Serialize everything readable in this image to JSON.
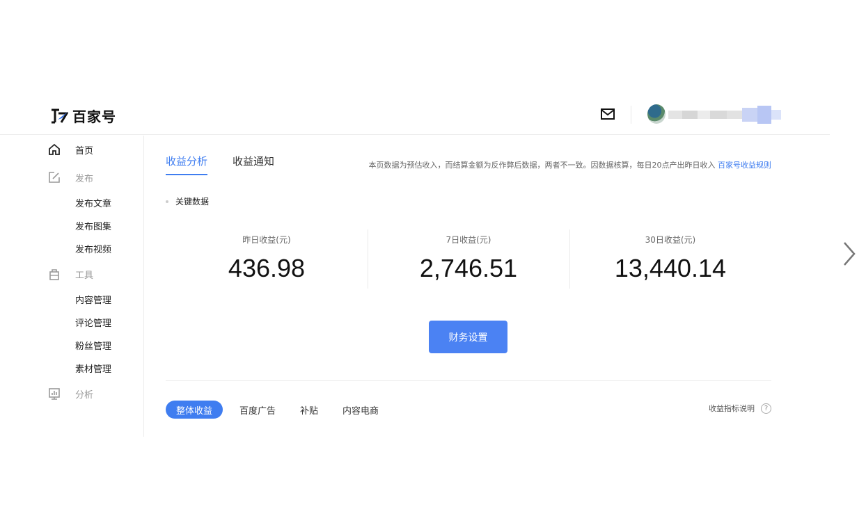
{
  "header": {
    "logo_text": "百家号",
    "mail_icon": "mail-icon",
    "avatar_icon": "avatar"
  },
  "sidebar": {
    "groups": [
      {
        "label": "首页",
        "icon": "home-icon",
        "items": []
      },
      {
        "label": "发布",
        "icon": "edit-icon",
        "items": [
          "发布文章",
          "发布图集",
          "发布视频"
        ]
      },
      {
        "label": "工具",
        "icon": "bag-icon",
        "items": [
          "内容管理",
          "评论管理",
          "粉丝管理",
          "素材管理"
        ]
      },
      {
        "label": "分析",
        "icon": "chart-icon",
        "items": []
      }
    ]
  },
  "main": {
    "tabs": [
      {
        "label": "收益分析",
        "active": true
      },
      {
        "label": "收益通知",
        "active": false
      }
    ],
    "notice": {
      "text": "本页数据为预估收入，而结算金额为反作弊后数据，两者不一致。因数据核算，每日20点产出昨日收入",
      "link": "百家号收益规则"
    },
    "section_label": "关键数据",
    "stats": [
      {
        "label": "昨日收益(元)",
        "value": "436.98"
      },
      {
        "label": "7日收益(元)",
        "value": "2,746.51"
      },
      {
        "label": "30日收益(元)",
        "value": "13,440.14"
      }
    ],
    "finance_button": "财务设置",
    "subtabs": [
      {
        "label": "整体收益",
        "active": true
      },
      {
        "label": "百度广告",
        "active": false
      },
      {
        "label": "补贴",
        "active": false
      },
      {
        "label": "内容电商",
        "active": false
      }
    ],
    "metric_help": "收益指标说明",
    "help_glyph": "?"
  },
  "colors": {
    "accent": "#3f7df0",
    "button": "#4b82f3"
  }
}
